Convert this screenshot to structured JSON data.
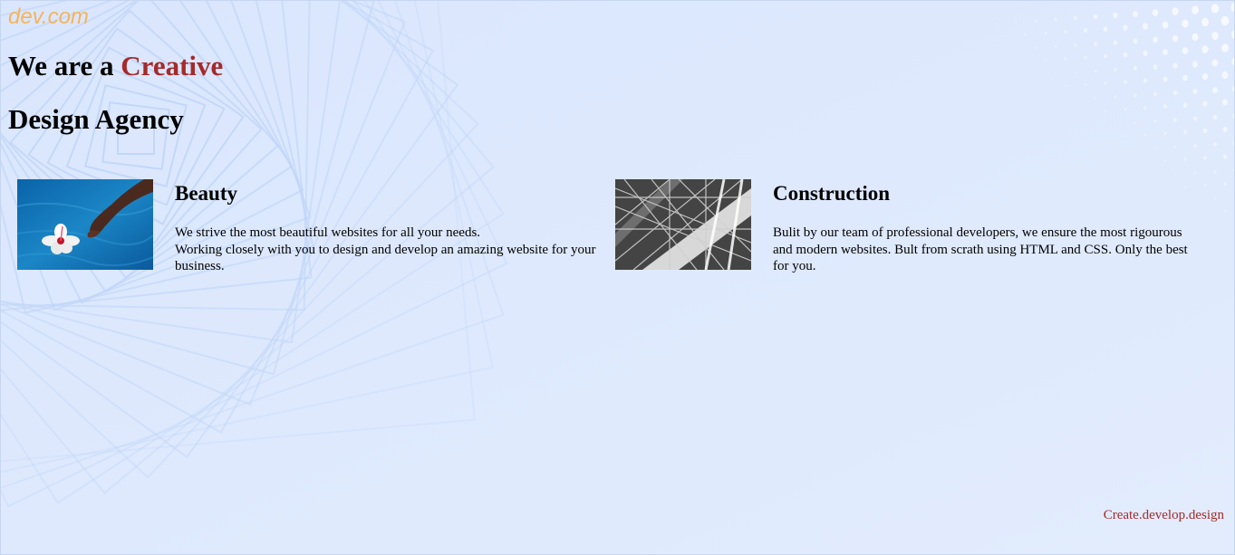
{
  "brand": {
    "logo": "dev.com"
  },
  "hero": {
    "line1_prefix": "We are a ",
    "line1_accent": "Creative",
    "line2": "Design Agency"
  },
  "services": [
    {
      "title": "Beauty",
      "description_lines": [
        "We strive the most beautiful websites for all your needs.",
        "Working closely with you to design and develop an amazing website for your business."
      ],
      "image_icon": "flower-on-water-photo"
    },
    {
      "title": "Construction",
      "description_lines": [
        "Bulit by our team of professional developers, we ensure the most rigourous and modern websites. Bult from scrath using HTML and CSS. Only the best for you."
      ],
      "image_icon": "steel-structure-photo"
    }
  ],
  "footer": {
    "tagline": "Create.develop.design"
  },
  "colors": {
    "background": "#dde9fd",
    "logo": "#f5b45b",
    "accent": "#a52a2a"
  }
}
